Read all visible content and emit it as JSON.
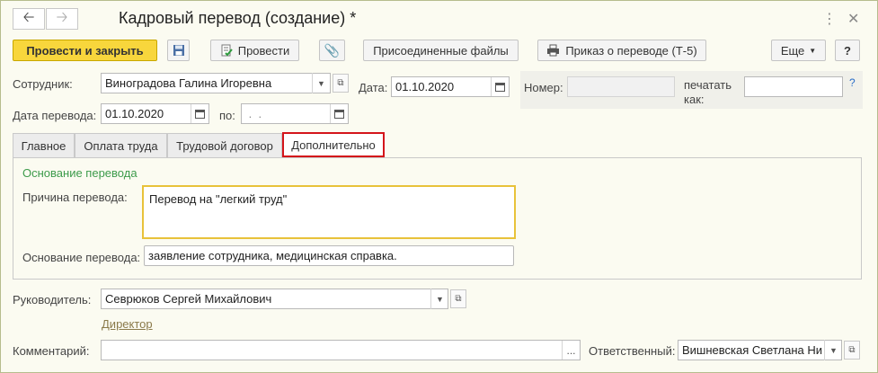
{
  "window": {
    "title": "Кадровый перевод (создание) *"
  },
  "toolbar": {
    "post_and_close": "Провести и закрыть",
    "post": "Провести",
    "attached_files": "Присоединенные файлы",
    "transfer_order": "Приказ о переводе (Т-5)",
    "more": "Еще",
    "help": "?"
  },
  "header": {
    "employee_label": "Сотрудник:",
    "employee_value": "Виноградова Галина Игоревна",
    "date_label": "Дата:",
    "date_value": "01.10.2020",
    "number_label": "Номер:",
    "number_value": "",
    "print_as_label1": "печатать",
    "print_as_label2": "как:",
    "print_as_value": "",
    "help_mark": "?",
    "transfer_date_label": "Дата перевода:",
    "transfer_date_value": "01.10.2020",
    "to_label": "по:",
    "to_value": " .  ."
  },
  "tabs": [
    {
      "label": "Главное"
    },
    {
      "label": "Оплата труда"
    },
    {
      "label": "Трудовой договор"
    },
    {
      "label": "Дополнительно"
    }
  ],
  "panel": {
    "section_title": "Основание перевода",
    "reason_label": "Причина перевода:",
    "reason_value": "Перевод на \"легкий труд\"",
    "basis_label": "Основание перевода:",
    "basis_value": "заявление сотрудника, медицинская справка."
  },
  "footer": {
    "manager_label": "Руководитель:",
    "manager_value": "Севрюков Сергей Михайлович",
    "manager_position": "Директор",
    "comment_label": "Комментарий:",
    "comment_value": "",
    "comment_btn": "...",
    "responsible_label": "Ответственный:",
    "responsible_value": "Вишневская Светлана Ни"
  },
  "colors": {
    "accent": "#f8d63c",
    "tab_highlight": "#d4151b",
    "section_title": "#3d9b4b",
    "focus_border": "#e8c23a"
  }
}
